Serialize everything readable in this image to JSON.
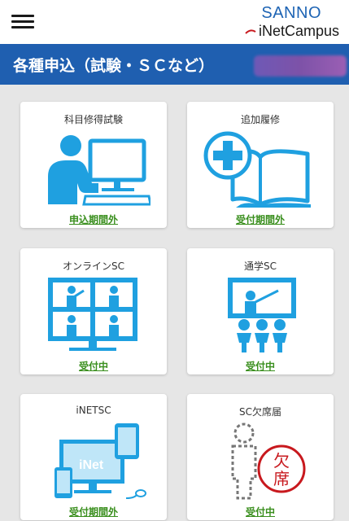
{
  "header": {
    "brand_line1": "SANNO",
    "brand_line2_prefix": "i",
    "brand_line2": "NetCampus"
  },
  "titlebar": {
    "title": "各種申込（試験・ＳＣなど）"
  },
  "cards": [
    {
      "label": "科目修得試験",
      "status": "申込期間外",
      "icon": "person-computer-icon"
    },
    {
      "label": "追加履修",
      "status": "受付期間外",
      "icon": "plus-book-icon"
    },
    {
      "label": "オンラインSC",
      "status": "受付中",
      "icon": "video-conference-icon"
    },
    {
      "label": "通学SC",
      "status": "受付中",
      "icon": "classroom-lecture-icon"
    },
    {
      "label": "iNETSC",
      "status": "受付期間外",
      "icon": "inet-devices-icon"
    },
    {
      "label": "SC欠席届",
      "status": "受付中",
      "icon": "absence-stamp-icon"
    }
  ],
  "colors": {
    "brand_blue": "#1f5fb0",
    "icon_blue": "#1fa0e0",
    "status_green": "#3a8f1e",
    "stamp_red": "#c8191e"
  }
}
